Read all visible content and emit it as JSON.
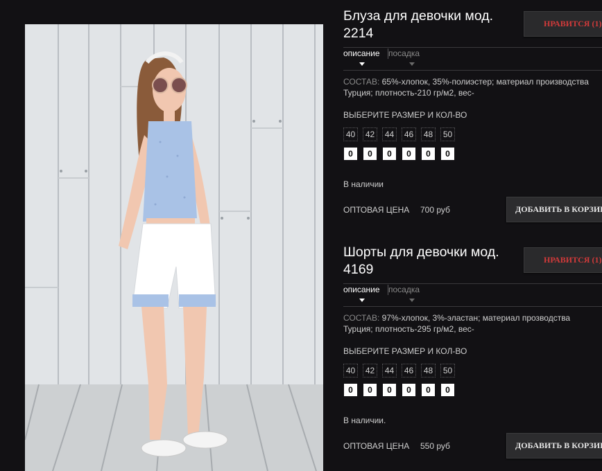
{
  "colors": {
    "background": "#121114",
    "accent_like": "#d23a3a",
    "button_bg": "#2c2c2e",
    "title": "#ffffff"
  },
  "photo": {
    "description_icon": "product-photo"
  },
  "products": [
    {
      "title_line1": "Блуза для девочки мод.",
      "title_line2": "2214",
      "like_label": "НРАВИТСЯ (1)",
      "tabs": [
        "описание",
        "посадка"
      ],
      "composition_label": "СОСТАВ:",
      "composition_text": "65%-хлопок, 35%-полиэстер; материал производства Турция; плотность-210 гр/м2, вес-",
      "size_prompt": "ВЫБЕРИТЕ РАЗМЕР И КОЛ-ВО",
      "sizes": [
        "40",
        "42",
        "44",
        "46",
        "48",
        "50"
      ],
      "quantities": [
        "0",
        "0",
        "0",
        "0",
        "0",
        "0"
      ],
      "stock": "В наличии",
      "price_label": "ОПТОВАЯ ЦЕНА",
      "price_value": "700 руб",
      "cart_label": "ДОБАВИТЬ В КОРЗИНУ"
    },
    {
      "title_line1": "Шорты для девочки мод.",
      "title_line2": "4169",
      "like_label": "НРАВИТСЯ (1)",
      "tabs": [
        "описание",
        "посадка"
      ],
      "composition_label": "СОСТАВ:",
      "composition_text": "97%-хлопок, 3%-эластан; материал прозводства Турция; плотность-295 гр/м2, вес-",
      "size_prompt": "ВЫБЕРИТЕ РАЗМЕР И КОЛ-ВО",
      "sizes": [
        "40",
        "42",
        "44",
        "46",
        "48",
        "50"
      ],
      "quantities": [
        "0",
        "0",
        "0",
        "0",
        "0",
        "0"
      ],
      "stock": "В наличии.",
      "price_label": "ОПТОВАЯ ЦЕНА",
      "price_value": "550 руб",
      "cart_label": "ДОБАВИТЬ В КОРЗИНУ"
    }
  ]
}
